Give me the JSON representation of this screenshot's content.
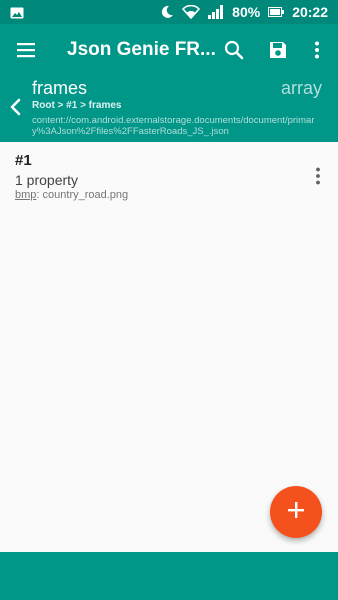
{
  "status_bar": {
    "battery": "80%",
    "time": "20:22",
    "icons": [
      "image-icon",
      "moon-icon",
      "wifi-icon",
      "signal-icon",
      "battery-icon"
    ]
  },
  "app_bar": {
    "title": "Json Genie FR...",
    "icons": [
      "menu-icon",
      "search-icon",
      "save-icon",
      "more-vertical-icon"
    ]
  },
  "path_header": {
    "node_name": "frames",
    "node_type": "array",
    "breadcrumb": "Root > #1 > frames",
    "uri": "content://com.android.externalstorage.documents/document/primary%3AJson%2Ffiles%2FFasterRoads_JS_.json"
  },
  "items": [
    {
      "title": "#1",
      "count": "1 property",
      "prop_key": "bmp",
      "prop_sep": ": ",
      "prop_value": "country_road.png"
    }
  ],
  "colors": {
    "primary": "#009688",
    "primary_dark": "#00897b",
    "accent": "#f4511e",
    "background": "#fafafa"
  }
}
